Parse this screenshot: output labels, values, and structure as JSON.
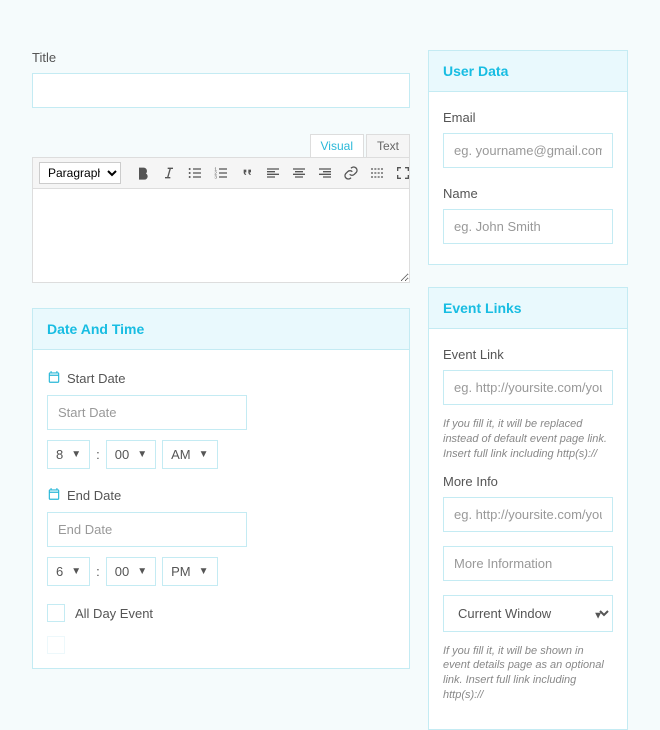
{
  "title": {
    "label": "Title",
    "value": ""
  },
  "editor": {
    "tabs": {
      "visual": "Visual",
      "text": "Text"
    },
    "paragraph_label": "Paragraph",
    "content": ""
  },
  "date_panel": {
    "header": "Date And Time",
    "start_label": "Start Date",
    "start_placeholder": "Start Date",
    "start_hour": "8",
    "start_min": "00",
    "start_ampm": "AM",
    "end_label": "End Date",
    "end_placeholder": "End Date",
    "end_hour": "6",
    "end_min": "00",
    "end_ampm": "PM",
    "allday_label": "All Day Event"
  },
  "user_panel": {
    "header": "User Data",
    "email_label": "Email",
    "email_placeholder": "eg. yourname@gmail.com",
    "name_label": "Name",
    "name_placeholder": "eg. John Smith"
  },
  "links_panel": {
    "header": "Event Links",
    "link_label": "Event Link",
    "link_placeholder": "eg. http://yoursite.com/your-event",
    "link_help": "If you fill it, it will be replaced instead of default event page link. Insert full link including http(s)://",
    "more_label": "More Info",
    "more_placeholder": "eg. http://yoursite.com/your-event",
    "more_title_placeholder": "More Information",
    "target_value": "Current Window",
    "more_help": "If you fill it, it will be shown in event details page as an optional link. Insert full link including http(s)://"
  }
}
